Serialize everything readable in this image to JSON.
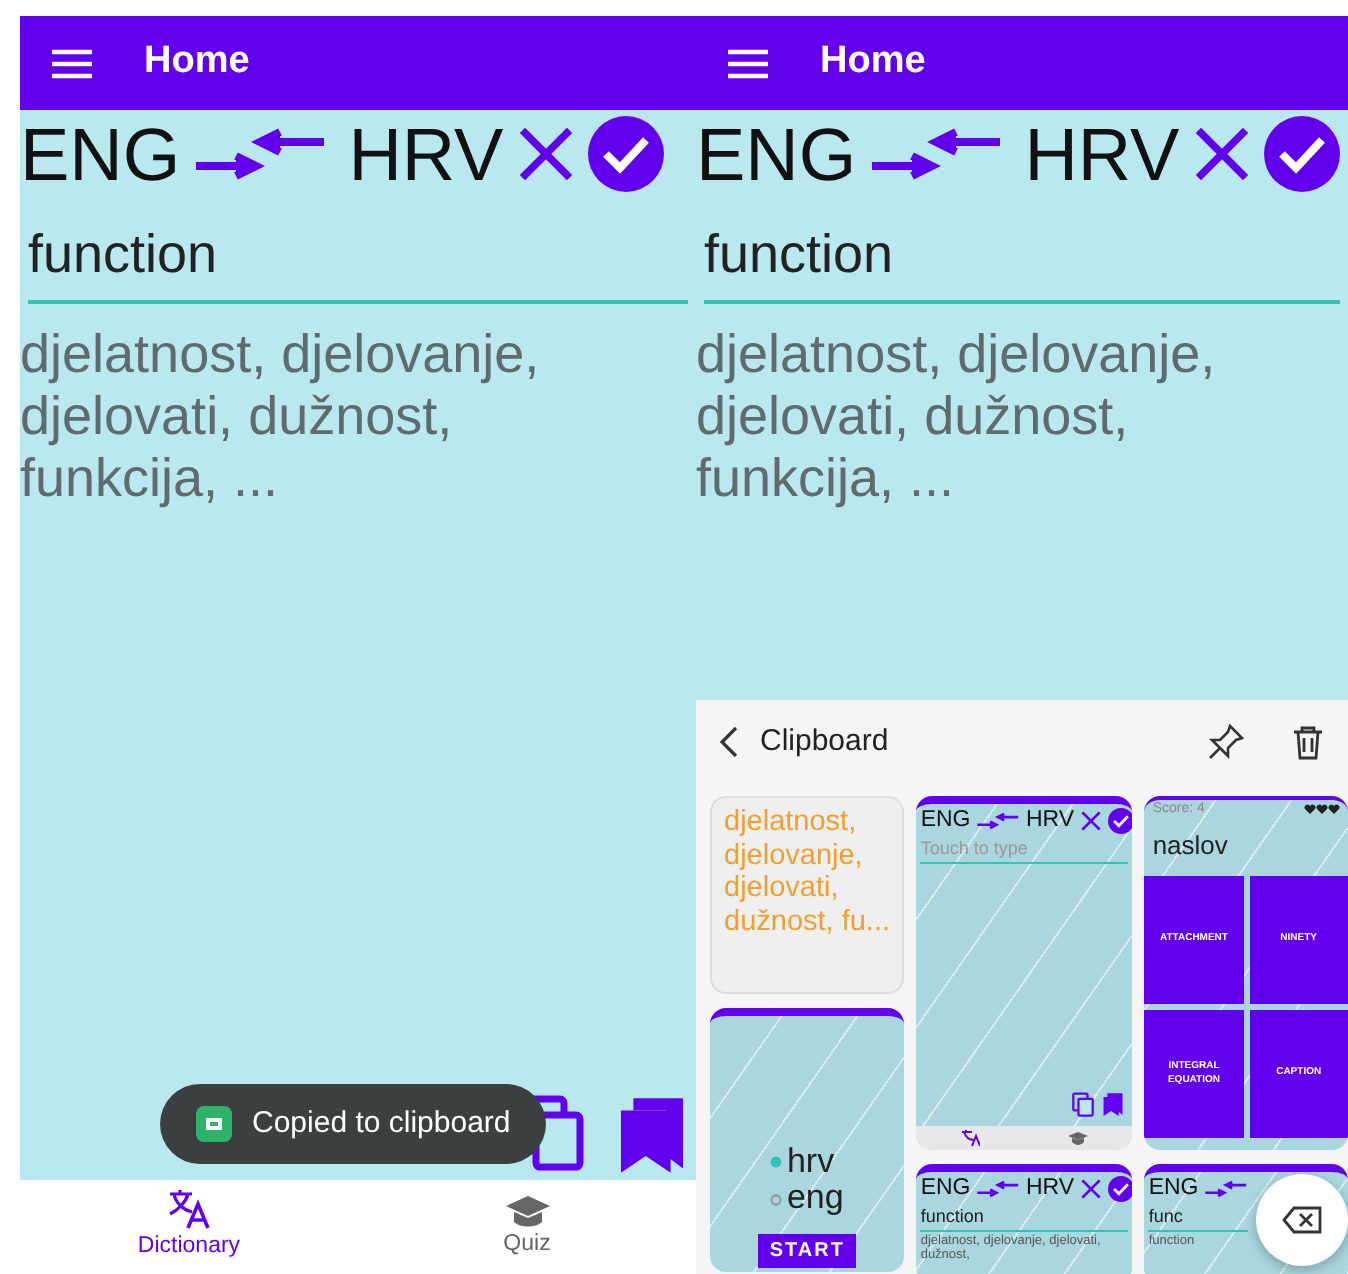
{
  "screens": [
    {
      "app_bar": {
        "title": "Home"
      },
      "languages": {
        "source": "ENG",
        "target": "HRV"
      },
      "search": {
        "value": "function"
      },
      "result": "djelatnost, djelovanje, djelovati, dužnost, funkcija, ...",
      "toast": {
        "text": "Copied to clipboard"
      },
      "bottom_nav": [
        {
          "label": "Dictionary",
          "selected": true
        },
        {
          "label": "Quiz",
          "selected": false
        }
      ]
    },
    {
      "app_bar": {
        "title": "Home"
      },
      "languages": {
        "source": "ENG",
        "target": "HRV"
      },
      "search": {
        "value": "function"
      },
      "result": "djelatnost, djelovanje, djelovati, dužnost, funkcija, ...",
      "clipboard": {
        "title": "Clipboard",
        "columns": [
          [
            {
              "kind": "text",
              "text": "djelatnost, djelovanje, djelovati, dužnost, fu..."
            },
            {
              "kind": "quiz",
              "options": [
                {
                  "label": "hrv",
                  "selected": true
                },
                {
                  "label": "eng",
                  "selected": false
                }
              ],
              "button": "START"
            }
          ],
          [
            {
              "kind": "dictionary",
              "source": "ENG",
              "target": "HRV",
              "placeholder": "Touch to type",
              "tools": true
            },
            {
              "kind": "dictionary",
              "source": "ENG",
              "target": "HRV",
              "value": "function",
              "result": "djelatnost, djelovanje, djelovati, dužnost,"
            }
          ],
          [
            {
              "kind": "score",
              "score": "Score: 4",
              "word": "naslov",
              "tiles": [
                "ATTACHMENT",
                "NINETY",
                "INTEGRAL EQUATION",
                "CAPTION"
              ]
            },
            {
              "kind": "dictionary",
              "source": "ENG",
              "value": "func",
              "result": "function"
            }
          ]
        ]
      }
    }
  ]
}
